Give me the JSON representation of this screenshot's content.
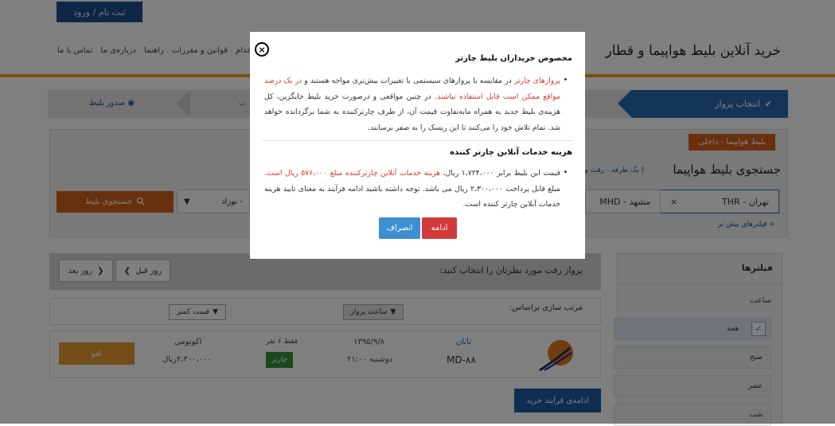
{
  "header": {
    "login_label": "ثبت نام / ورود",
    "site_title": "خرید آنلاین بلیط هواپیما و قطار",
    "nav": [
      "استخدام",
      "قوانین و مقررات",
      "راهنما",
      "درباره‌ی ما",
      "تماس با ما"
    ]
  },
  "steps": {
    "active": "انتخاب پرواز",
    "middle": "ت",
    "issue": "صدور بلیط"
  },
  "search": {
    "badge": "بلیط هواپیما - داخلی",
    "title": "جستجوی بلیط هواپیما",
    "subtitle": "( یک طرفه - رفت و برگشت",
    "origin": "تهران - THR",
    "origin_clear": "×",
    "destination": "مشهد - MHD",
    "passengers": "- نوزاد",
    "passengers_arrow": "▼",
    "search_button": "جستجوی بلیط",
    "more_filters": "+ فیلترهای بیش تر"
  },
  "filters": {
    "title": "فیلترها",
    "time_label": "ساعت",
    "options": [
      "همه",
      "صبح",
      "عصر",
      "شب"
    ]
  },
  "results": {
    "title": "پرواز رفت مورد نظرتان را انتخاب کنید:",
    "prev_day": "روز قبل",
    "next_day": "روز بعد",
    "sort_label": "مرتب سازی براساس:",
    "sort_time": "ساعت پرواز",
    "sort_price": "قیمت کمتر",
    "flight": {
      "airline": "تابان",
      "flight_no": "MD-۸۸",
      "date": "۱۳۹۵/۹/۸",
      "day_time": "دوشنبه ۲۱:۰۰",
      "seats": "فقط ۶ نفر",
      "type": "چارتر",
      "cabin": "اکونومی",
      "price": "۲،۳۰۰،۰۰۰ریال",
      "action": "لغو"
    },
    "continue_button": "ادامه‌ی فرآیند خرید"
  },
  "modal": {
    "close": "×",
    "heading1": "مخصوص خریداران بلیط چارتر",
    "p1_red1": "پروازهای چارتر",
    "p1_text1": " در مقایسه با پروازهای سیستمی با تغییرات بیش‌تری مواجه هستند و ",
    "p1_red2": "در یک درصد مواقع ممکن است قابل استفاده نباشند.",
    "p1_text2": " در چنین مواقعی و درصورت خرید بلیط جایگزین، کل هزینه‌ی بلیط جدید به همراه مابه‌تفاوت قیمت آن، از طرف چارترکننده به شما برگردانده خواهد شد.         تمام تلاش خود را می‌کنند تا این ریسک را به صفر برسانند.",
    "heading2": "هزینه خدمات آنلاین چارتر کننده",
    "p2_text1": "قیمت این بلیط برابر ۱،۷۲۴،۰۰۰ ریال، ",
    "p2_red": "هزینه خدمات آنلاین چارترکننده مبلغ ۵۷۶،۰۰۰ ریال است.",
    "p2_text2": " مبلغ قابل پرداخت ۲،۳۰۰،۰۰۰ ریال می باشد. توجه داشته باشید ادامه فرآیند به معنای تایید هزینه خدمات آنلاین چارتر کننده است.",
    "bullet": "•",
    "continue_label": "ادامه",
    "cancel_label": "انصراف"
  },
  "colors": {
    "primary_blue": "#2a6bb0",
    "orange": "#d2601a",
    "accent": "#f0a21c",
    "red": "#d33b2c",
    "modal_continue": "#d03b3a",
    "modal_cancel": "#3e8fd1"
  }
}
